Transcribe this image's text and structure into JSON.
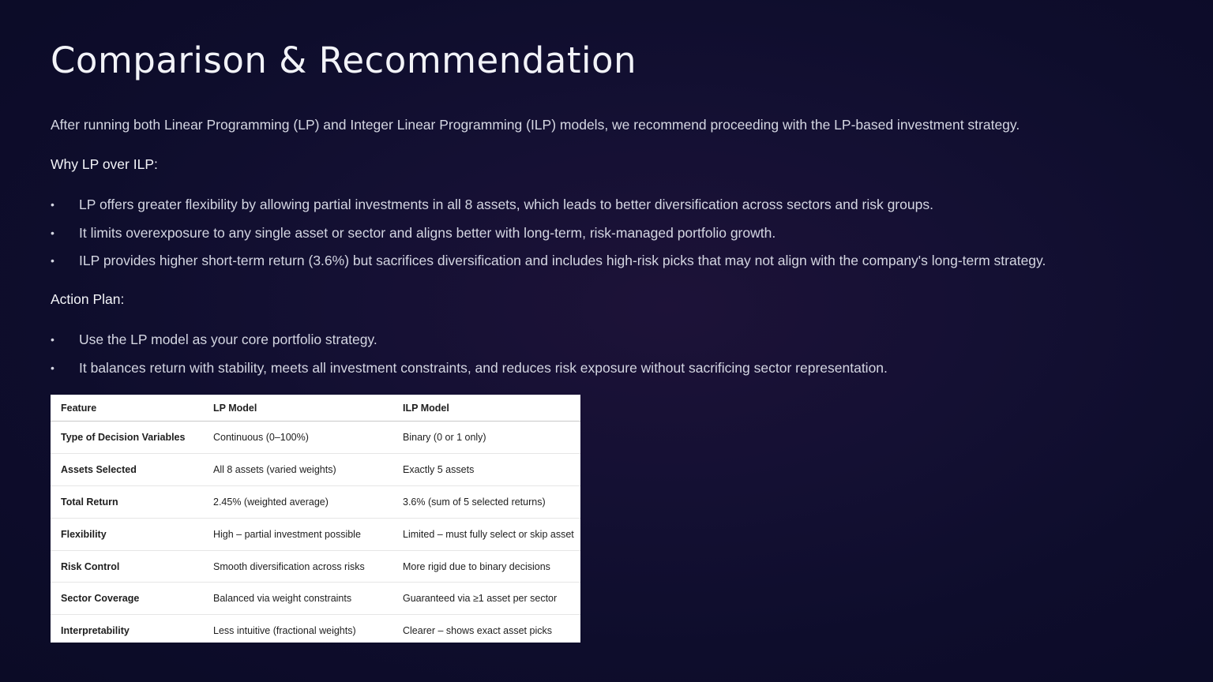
{
  "title": "Comparison & Recommendation",
  "intro": "After running both Linear Programming (LP) and Integer Linear Programming (ILP) models, we recommend proceeding with the LP-based investment strategy.",
  "why": {
    "heading": "Why LP over ILP:",
    "bullets": [
      "LP offers greater flexibility by allowing partial investments in all 8 assets, which leads to better diversification across sectors and risk groups.",
      "It limits overexposure to any single asset or sector and aligns better with long-term, risk-managed portfolio growth.",
      "ILP provides higher short-term return (3.6%) but sacrifices diversification and includes high-risk picks that may not align with the company's long-term strategy."
    ]
  },
  "action": {
    "heading": "Action Plan:",
    "bullets": [
      "Use the LP model as your core portfolio strategy.",
      "It balances return with stability, meets all investment constraints, and reduces risk exposure without sacrificing sector representation."
    ]
  },
  "bullet_char": "•",
  "table": {
    "headers": [
      "Feature",
      "LP Model",
      "ILP Model"
    ],
    "rows": [
      [
        "Type of Decision Variables",
        "Continuous (0–100%)",
        "Binary (0 or 1 only)"
      ],
      [
        "Assets Selected",
        "All 8 assets (varied weights)",
        "Exactly 5 assets"
      ],
      [
        "Total Return",
        "2.45% (weighted average)",
        "3.6% (sum of 5 selected returns)"
      ],
      [
        "Flexibility",
        "High – partial investment possible",
        "Limited – must fully select or skip asset"
      ],
      [
        "Risk Control",
        "Smooth diversification across risks",
        "More rigid due to binary decisions"
      ],
      [
        "Sector Coverage",
        "Balanced via weight constraints",
        "Guaranteed via ≥1 asset per sector"
      ],
      [
        "Interpretability",
        "Less intuitive (fractional weights)",
        "Clearer – shows exact asset picks"
      ]
    ]
  }
}
